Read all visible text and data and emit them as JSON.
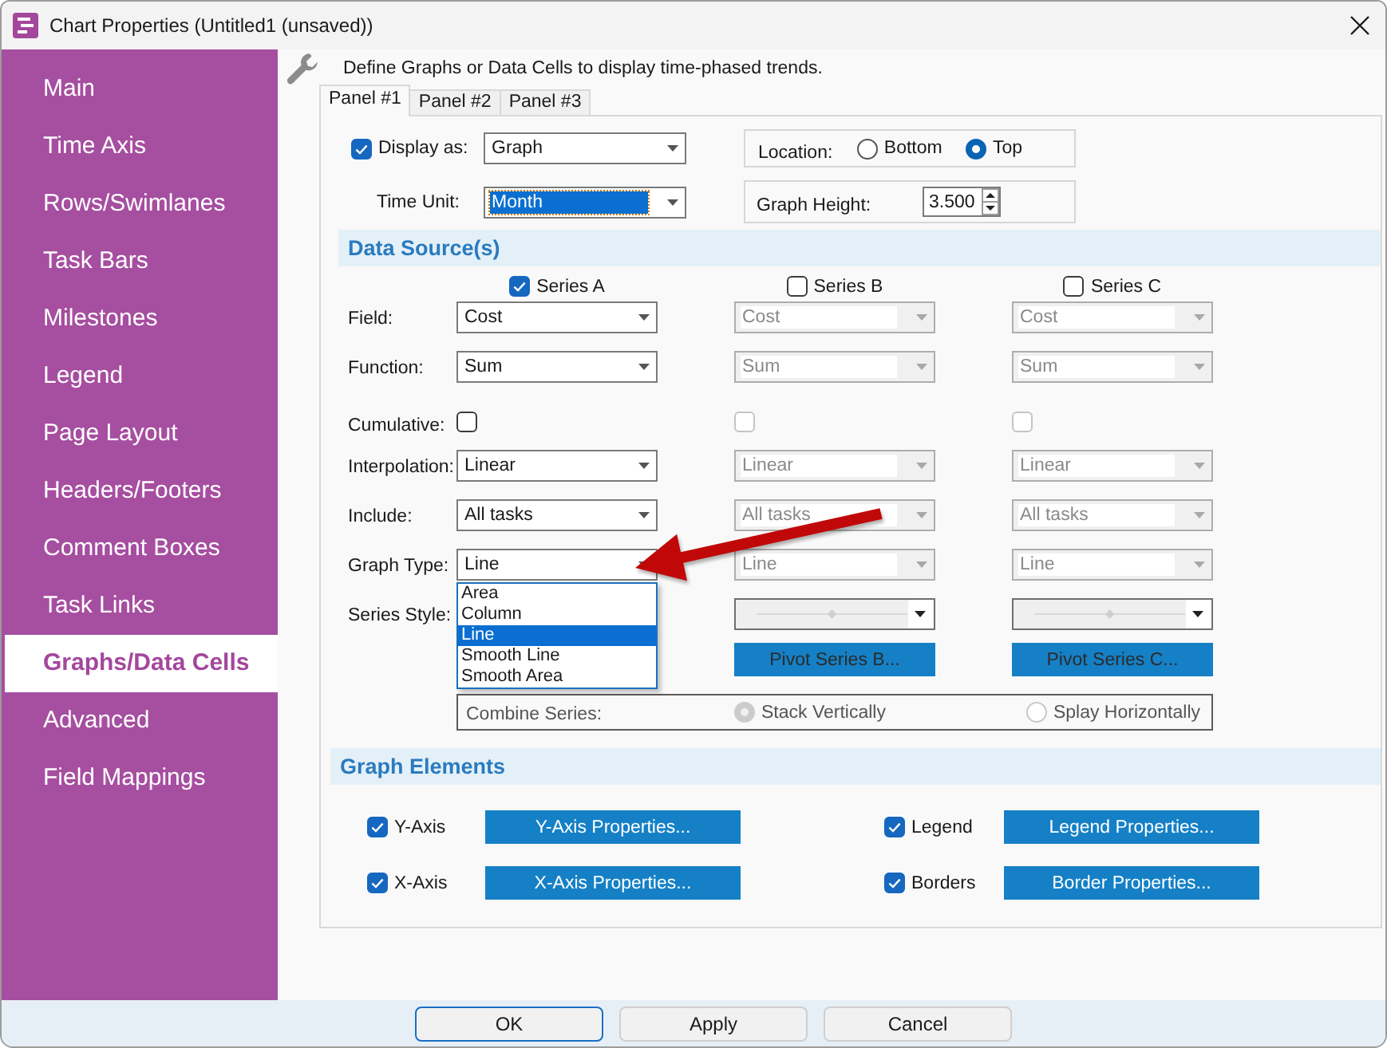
{
  "window": {
    "title": "Chart Properties (Untitled1 (unsaved))"
  },
  "sidebar": {
    "items": [
      {
        "label": "Main",
        "selected": false
      },
      {
        "label": "Time Axis",
        "selected": false
      },
      {
        "label": "Rows/Swimlanes",
        "selected": false
      },
      {
        "label": "Task Bars",
        "selected": false
      },
      {
        "label": "Milestones",
        "selected": false
      },
      {
        "label": "Legend",
        "selected": false
      },
      {
        "label": "Page Layout",
        "selected": false
      },
      {
        "label": "Headers/Footers",
        "selected": false
      },
      {
        "label": "Comment Boxes",
        "selected": false
      },
      {
        "label": "Task Links",
        "selected": false
      },
      {
        "label": "Graphs/Data Cells",
        "selected": true
      },
      {
        "label": "Advanced",
        "selected": false
      },
      {
        "label": "Field Mappings",
        "selected": false
      }
    ]
  },
  "description": "Define Graphs or Data Cells to display time-phased trends.",
  "tabs": [
    {
      "label": "Panel #1",
      "selected": true
    },
    {
      "label": "Panel #2",
      "selected": false
    },
    {
      "label": "Panel #3",
      "selected": false
    }
  ],
  "display_as": {
    "label": "Display as:",
    "checked": true,
    "value": "Graph"
  },
  "time_unit": {
    "label": "Time Unit:",
    "value": "Month",
    "focused": true
  },
  "location": {
    "label": "Location:",
    "options": [
      {
        "label": "Bottom",
        "selected": false
      },
      {
        "label": "Top",
        "selected": true
      }
    ]
  },
  "graph_height": {
    "label": "Graph Height:",
    "value": "3.500"
  },
  "data_source": {
    "title": "Data Source(s)",
    "row_labels": [
      "Field:",
      "Function:",
      "Cumulative:",
      "Interpolation:",
      "Include:",
      "Graph Type:",
      "Series Style:"
    ],
    "series": [
      {
        "label": "Series A",
        "checked": true,
        "disabled": false,
        "cells": [
          {
            "kind": "dropdown",
            "value": "Cost"
          },
          {
            "kind": "dropdown",
            "value": "Sum"
          },
          {
            "kind": "checkbox",
            "checked": false
          },
          {
            "kind": "dropdown",
            "value": "Linear"
          },
          {
            "kind": "dropdown",
            "value": "All tasks"
          },
          {
            "kind": "dropdown",
            "value": "Line",
            "options": [
              {
                "label": "Area",
                "selected": false
              },
              {
                "label": "Column",
                "selected": false
              },
              {
                "label": "Line",
                "selected": true
              },
              {
                "label": "Smooth Line",
                "selected": false
              },
              {
                "label": "Smooth Area",
                "selected": false
              }
            ]
          }
        ]
      },
      {
        "label": "Series B",
        "checked": false,
        "disabled": true,
        "cells": [
          {
            "kind": "dropdown",
            "value": "Cost"
          },
          {
            "kind": "dropdown",
            "value": "Sum"
          },
          {
            "kind": "checkbox",
            "checked": false
          },
          {
            "kind": "dropdown",
            "value": "Linear"
          },
          {
            "kind": "dropdown",
            "value": "All tasks"
          },
          {
            "kind": "dropdown",
            "value": "Line"
          },
          {
            "kind": "line_style"
          },
          {
            "kind": "button",
            "label": "Pivot Series B..."
          }
        ]
      },
      {
        "label": "Series C",
        "checked": false,
        "disabled": true,
        "cells": [
          {
            "kind": "dropdown",
            "value": "Cost"
          },
          {
            "kind": "dropdown",
            "value": "Sum"
          },
          {
            "kind": "checkbox",
            "checked": false
          },
          {
            "kind": "dropdown",
            "value": "Linear"
          },
          {
            "kind": "dropdown",
            "value": "All tasks"
          },
          {
            "kind": "dropdown",
            "value": "Line"
          },
          {
            "kind": "line_style"
          },
          {
            "kind": "button",
            "label": "Pivot Series C..."
          }
        ]
      }
    ],
    "combine": {
      "label": "Combine Series:",
      "disabled": true,
      "options": [
        {
          "label": "Stack Vertically",
          "selected": true
        },
        {
          "label": "Splay Horizontally",
          "selected": false
        }
      ]
    }
  },
  "graph_elements": {
    "title": "Graph Elements",
    "items": [
      {
        "label": "Y-Axis",
        "checked": true,
        "button": "Y-Axis Properties..."
      },
      {
        "label": "Legend",
        "checked": true,
        "button": "Legend Properties..."
      },
      {
        "label": "X-Axis",
        "checked": true,
        "button": "X-Axis Properties..."
      },
      {
        "label": "Borders",
        "checked": true,
        "button": "Border Properties..."
      }
    ]
  },
  "footer_buttons": [
    {
      "label": "OK",
      "default": true
    },
    {
      "label": "Apply",
      "default": false
    },
    {
      "label": "Cancel",
      "default": false
    }
  ]
}
